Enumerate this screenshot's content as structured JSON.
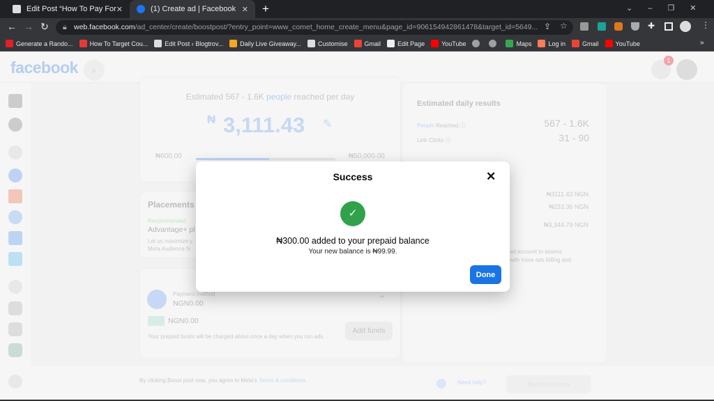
{
  "browser": {
    "tabs": [
      {
        "title": "Edit Post “How To Pay For Facebo",
        "active": false
      },
      {
        "title": "(1) Create ad | Facebook",
        "active": true
      }
    ],
    "new_tab": "+",
    "url_domain": "web.facebook.com",
    "url_path": "/ad_center/create/boostpost/?entry_point=www_comet_home_create_menu&page_id=906154942861478&target_id=5649...",
    "bookmarks": [
      {
        "label": "Generate a Rando...",
        "color": "#e41e26"
      },
      {
        "label": "How To Target Cou...",
        "color": "#e53935"
      },
      {
        "label": "Edit Post ‹ Blogtrov...",
        "color": "#ddd"
      },
      {
        "label": "Daily Live Giveaway...",
        "color": "#f5a623"
      },
      {
        "label": "Customise",
        "color": "#ddd"
      },
      {
        "label": "Gmail",
        "color": "#ea4335"
      },
      {
        "label": "Edit Page",
        "color": "#eee"
      },
      {
        "label": "YouTube",
        "color": "#ff0000"
      },
      {
        "label": "",
        "color": "#9aa0a6"
      },
      {
        "label": "",
        "color": "#9aa0a6"
      },
      {
        "label": "Maps",
        "color": "#34a853"
      },
      {
        "label": "Log in",
        "color": "#ff7a59"
      },
      {
        "label": "Gmail",
        "color": "#ea4335"
      },
      {
        "label": "YouTube",
        "color": "#ff0000"
      }
    ],
    "more": "»"
  },
  "fb": {
    "logo": "facebook",
    "notification_count": "1"
  },
  "budget": {
    "estimate_prefix": "Estimated 567 - 1.6K ",
    "estimate_link": "people",
    "estimate_suffix": " reached per day",
    "currency": "₦",
    "amount": "3,111.43",
    "min": "₦600.00",
    "max": "₦50,000.00",
    "slider_fraction": 0.05
  },
  "placements": {
    "title": "Placements",
    "recommended": "Recommended",
    "option": "Advantage+ pl",
    "desc1": "Let us maximize y",
    "desc2": "Meta Audience N"
  },
  "payment": {
    "label": "Payment method",
    "value": "NGN0.00",
    "balance": "NGN0.00",
    "note": "Your prepaid funds will be charged about once a day when you run ads.",
    "add_funds": "Add funds"
  },
  "results": {
    "title": "Estimated daily results",
    "people_link": "People",
    "people_label": " Reached",
    "people_value": "567 - 1.6K",
    "clicks_label": "Link Clicks",
    "clicks_value": "31 - 90",
    "budget_value": "₦3111.43 NGN",
    "tax_value": "₦233.36 NGN",
    "total_value": "₦3,344.79 NGN",
    "note1": "ad account to assess",
    "note2": "with more ads billing and"
  },
  "footer": {
    "agree": "By clicking Boost post now, you agree to Meta's ",
    "terms": "Terms & conditions",
    "help": "Need help?",
    "boost": "Boost post now"
  },
  "modal": {
    "title": "Success",
    "message": "₦300.00 added to your prepaid balance",
    "sub": "Your new balance is ₦99.99.",
    "done": "Done",
    "close": "✕",
    "accent": "#1b74e4",
    "success_color": "#31a24c"
  }
}
